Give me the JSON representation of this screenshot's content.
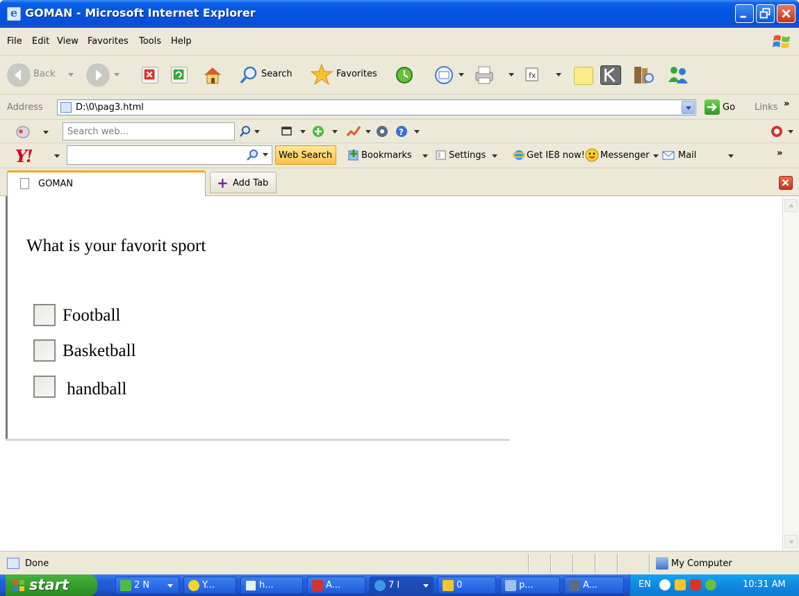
{
  "window": {
    "title": "GOMAN - Microsoft Internet Explorer"
  },
  "menu": [
    "File",
    "Edit",
    "View",
    "Favorites",
    "Tools",
    "Help"
  ],
  "toolbar": {
    "back_label": "Back",
    "search_label": "Search",
    "favorites_label": "Favorites"
  },
  "address": {
    "label": "Address",
    "value": "D:\\0\\pag3.html",
    "go_label": "Go",
    "links_label": "Links",
    "links_chevron": "»"
  },
  "search_toolbar": {
    "placeholder": "Search web..."
  },
  "yahoo_toolbar": {
    "logo": "Y!",
    "search_value": "",
    "web_search_label": "Web Search",
    "bookmarks_label": "Bookmarks",
    "settings_label": "Settings",
    "get_ie8_label": "Get IE8 now!",
    "messenger_label": "Messenger",
    "mail_label": "Mail",
    "more_chevron": "»"
  },
  "tabs": {
    "active_label": "GOMAN",
    "add_label": "Add Tab"
  },
  "page": {
    "question": "What is your favorit sport",
    "options": [
      {
        "label": "Football",
        "checked": false
      },
      {
        "label": "Basketball",
        "checked": false
      },
      {
        "label": " handball",
        "checked": false
      }
    ]
  },
  "status": {
    "text": "Done",
    "zone": "My Computer"
  },
  "taskbar": {
    "start_label": "start",
    "tasks": [
      "2 N",
      "Y...",
      "h...",
      "A...",
      "7 I",
      "0",
      "p...",
      "A..."
    ],
    "language": "EN",
    "clock": "10:31 AM"
  },
  "colors": {
    "title_bar": "#0454e0",
    "chrome": "#ece9d8",
    "taskbar": "#245edb",
    "start_button": "#36a02d",
    "tray": "#0f8ae0"
  }
}
